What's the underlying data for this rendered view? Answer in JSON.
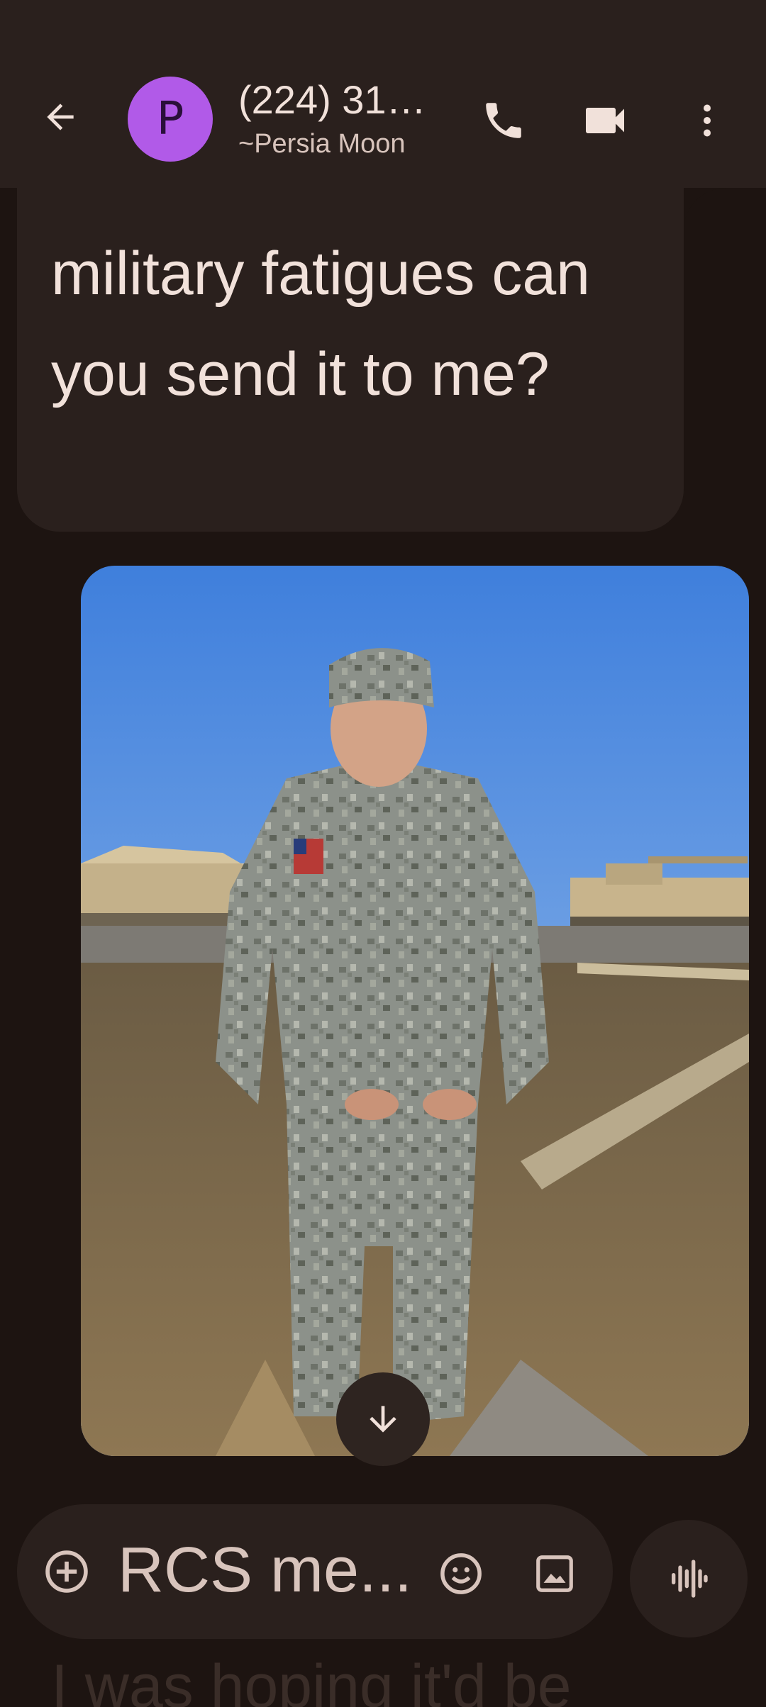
{
  "header": {
    "avatar_letter": "P",
    "contact_number": "(224) 316...",
    "contact_name": "~Persia Moon",
    "avatar_color": "#b15ae8",
    "icons": [
      "back-arrow-icon",
      "phone-icon",
      "video-camera-icon",
      "more-vert-icon"
    ]
  },
  "conversation": {
    "incoming_message": "military fatigues can you send it to me?",
    "partial_next_message": "I was hoping it'd be"
  },
  "compose": {
    "placeholder": "RCS me...",
    "icons": [
      "add-circle-icon",
      "emoji-icon",
      "gallery-icon",
      "voice-waveform-icon"
    ]
  },
  "colors": {
    "background": "#1d1411",
    "surface": "#2a201d",
    "text": "#f1e1da"
  }
}
